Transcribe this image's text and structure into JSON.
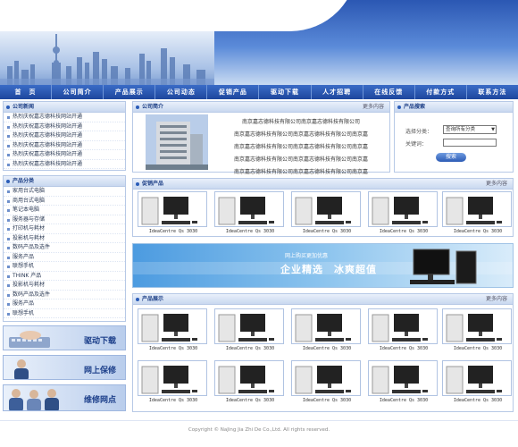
{
  "nav": [
    "首　页",
    "公司简介",
    "产品展示",
    "公司动态",
    "促销产品",
    "驱动下载",
    "人才招聘",
    "在线反馈",
    "付款方式",
    "联系方法"
  ],
  "news": {
    "title": "公司新闻",
    "items": [
      "热烈庆祝嘉志德科技网站开通",
      "热烈庆祝嘉志德科技网站开通",
      "热烈庆祝嘉志德科技网站开通",
      "热烈庆祝嘉志德科技网站开通",
      "热烈庆祝嘉志德科技网站开通",
      "热烈庆祝嘉志德科技网站开通"
    ]
  },
  "categories": {
    "title": "产品分类",
    "items": [
      "家用台式电脑",
      "商用台式电脑",
      "笔记本电脑",
      "服务器与存储",
      "打印机与耗材",
      "投影机与耗材",
      "数码产品及选件",
      "服务产品",
      "联想手机",
      "THINK 产品",
      "投影机与耗材",
      "数码产品及选件",
      "服务产品",
      "联想手机"
    ]
  },
  "banners": [
    "驱动下载",
    "网上保修",
    "维修网点"
  ],
  "about": {
    "title": "公司简介",
    "more": "更多内容",
    "lines": [
      "南京嘉志德科技有限公司南京嘉志德科技有限公司",
      "南京嘉志德科技有限公司南京嘉志德科技有限公司南京嘉",
      "南京嘉志德科技有限公司南京嘉志德科技有限公司南京嘉",
      "南京嘉志德科技有限公司南京嘉志德科技有限公司南京嘉",
      "南京嘉志德科技有限公司南京嘉志德科技有限公司南京嘉"
    ]
  },
  "search": {
    "title": "产品搜索",
    "category_label": "选择分类：",
    "category_value": "查询所有分类",
    "keyword_label": "关键词：",
    "button": "搜索"
  },
  "promo": {
    "title": "促销产品",
    "more": "更多内容",
    "items": [
      "IdeaCentre Qs 3030",
      "IdeaCentre Qs 3030",
      "IdeaCentre Qs 3030",
      "IdeaCentre Qs 3030",
      "IdeaCentre Qs 3030"
    ]
  },
  "ad": {
    "small": "网上购买更加优惠",
    "big": "企业精选　冰爽超值"
  },
  "showcase": {
    "title": "产品展示",
    "more": "更多内容",
    "items": [
      "IdeaCentre Qs 3030",
      "IdeaCentre Qs 3030",
      "IdeaCentre Qs 3030",
      "IdeaCentre Qs 3030",
      "IdeaCentre Qs 3030",
      "IdeaCentre Qs 3030",
      "IdeaCentre Qs 3030",
      "IdeaCentre Qs 3030",
      "IdeaCentre Qs 3030",
      "IdeaCentre Qs 3030"
    ]
  },
  "footer": "Copyright © NaJing Jia Zhi De  Co.,Ltd. All rights reserved."
}
